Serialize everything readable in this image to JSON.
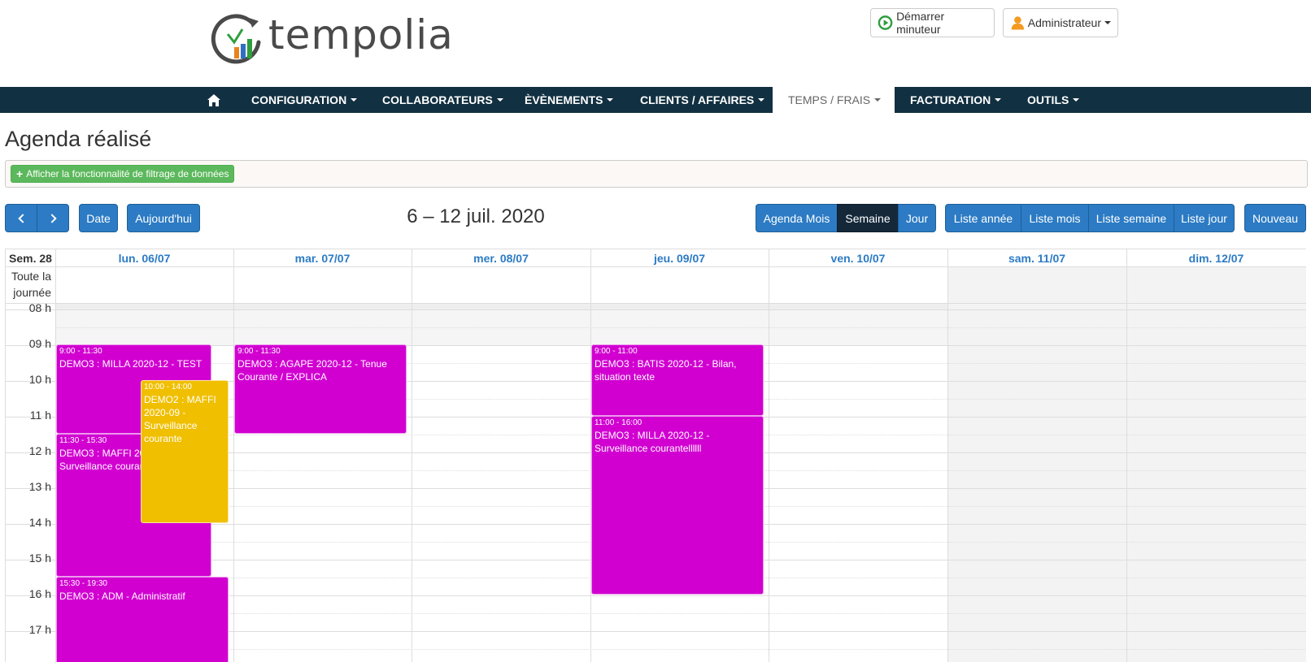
{
  "header": {
    "brand": "tempolia",
    "timer_label": "Démarrer minuteur",
    "user_label": "Administrateur"
  },
  "nav": {
    "home_icon": "home-icon",
    "items": [
      {
        "label": "CONFIGURATION"
      },
      {
        "label": "COLLABORATEURS"
      },
      {
        "label": "ÈVÈNEMENTS"
      },
      {
        "label": "CLIENTS / AFFAIRES"
      },
      {
        "label": "TEMPS / FRAIS",
        "active": true
      },
      {
        "label": "FACTURATION"
      },
      {
        "label": "OUTILS"
      }
    ]
  },
  "page": {
    "title": "Agenda réalisé",
    "filter_label": "Afficher la fonctionnalité de filtrage de données"
  },
  "toolbar": {
    "date_label": "Date",
    "today_label": "Aujourd'hui",
    "range_title": "6 – 12 juil. 2020",
    "views": [
      "Agenda Mois",
      "Semaine",
      "Jour"
    ],
    "active_view": "Semaine",
    "lists": [
      "Liste année",
      "Liste mois",
      "Liste semaine",
      "Liste jour"
    ],
    "new_label": "Nouveau"
  },
  "calendar": {
    "week_label": "Sem. 28",
    "allday_label": "Toute la journée",
    "days": [
      "lun. 06/07",
      "mar. 07/07",
      "mer. 08/07",
      "jeu. 09/07",
      "ven. 10/07",
      "sam. 11/07",
      "dim. 12/07"
    ],
    "hours": [
      "08 h",
      "09 h",
      "10 h",
      "11 h",
      "12 h",
      "13 h",
      "14 h",
      "15 h",
      "16 h",
      "17 h"
    ],
    "events": [
      {
        "time": "9:00 - 11:30",
        "title": "DEMO3 : MILLA 2020-12 - TEST",
        "color": "#d100d1"
      },
      {
        "time": "10:00 - 14:00",
        "title": "DEMO2 : MAFFI 2020-09 - Surveillance courante",
        "color": "#f0bf00"
      },
      {
        "time": "11:30 - 15:30",
        "title": "DEMO3 : MAFFI 2020-12 - Surveillance courante",
        "color": "#d100d1"
      },
      {
        "time": "15:30 - 19:30",
        "title": "DEMO3 : ADM - Administratif",
        "color": "#d100d1"
      },
      {
        "time": "9:00 - 11:30",
        "title": "DEMO3 : AGAPE 2020-12 - Tenue Courante / EXPLICA",
        "color": "#d100d1"
      },
      {
        "time": "9:00 - 11:00",
        "title": "DEMO3 : BATIS 2020-12 - Bilan, situation texte",
        "color": "#d100d1"
      },
      {
        "time": "11:00 - 16:00",
        "title": "DEMO3 : MILLA 2020-12 - Surveillance courantellllll",
        "color": "#d100d1"
      }
    ]
  }
}
